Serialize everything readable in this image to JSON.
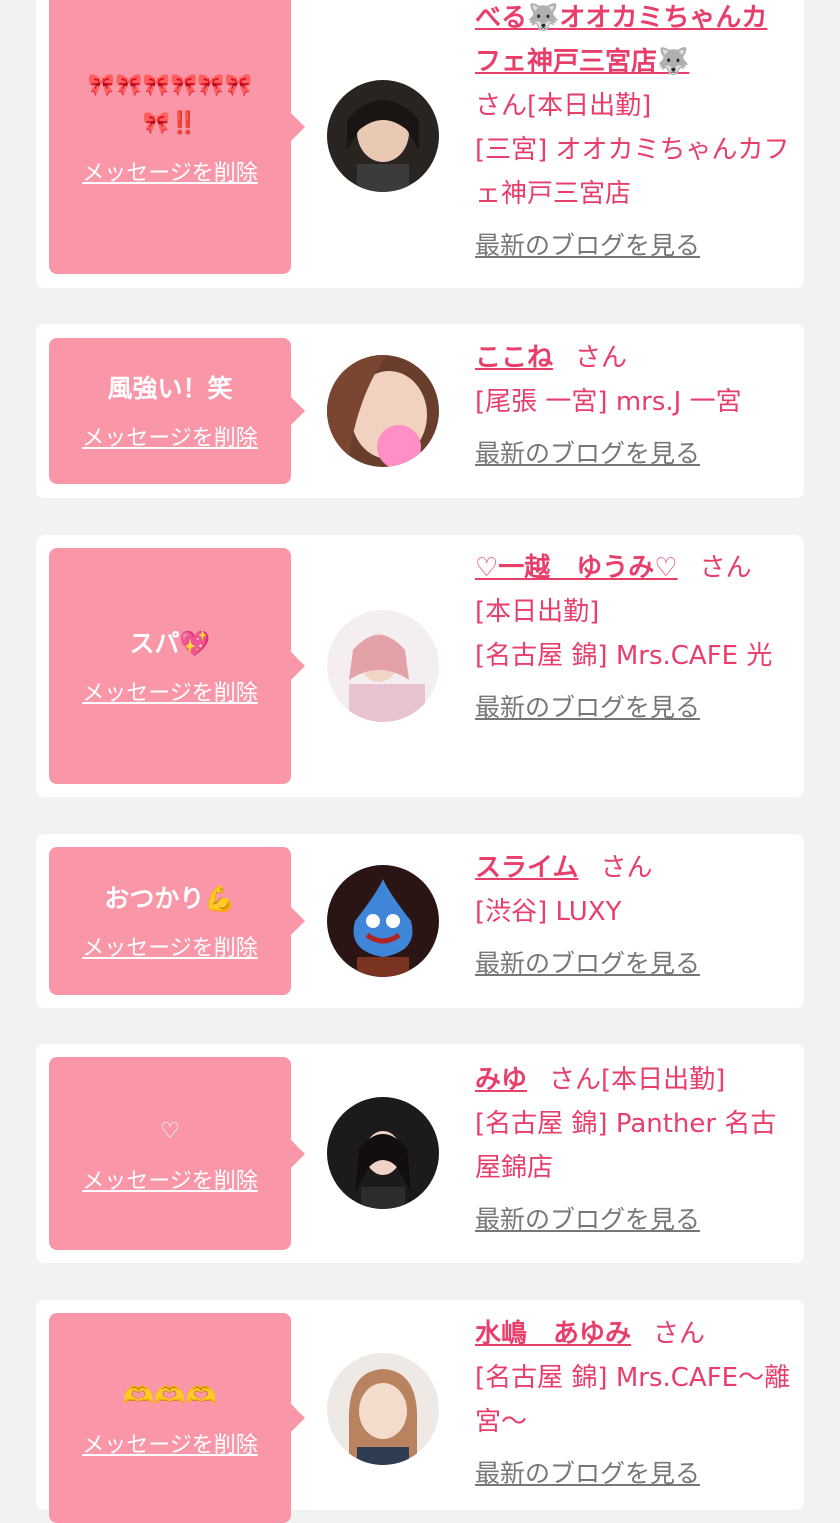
{
  "colors": {
    "accent": "#e83e6c",
    "bubble": "#f997a8",
    "background": "#f2f2f2",
    "card": "#ffffff",
    "blog_link": "#777777"
  },
  "common": {
    "delete_label": "メッセージを削除",
    "blog_label": "最新のブログを見る",
    "san_label": "さん"
  },
  "cards": [
    {
      "message": "🎀🎀🎀🎀🎀🎀🎀‼️",
      "name": "べる🐺オオカミちゃんカフェ神戸三宮店🐺",
      "san_line": "さん[本日出勤]",
      "shop": "[三宮] オオカミちゃんカフェ神戸三宮店",
      "avatar_icon": "user-photo-icon"
    },
    {
      "message": "風強い！笑",
      "name": "ここね",
      "san_line": "さん",
      "shop": "[尾張 一宮] mrs.J 一宮",
      "avatar_icon": "user-photo-icon"
    },
    {
      "message": "スパ💖",
      "name": "♡一越　ゆうみ♡",
      "san_line": "さん",
      "status": "[本日出勤]",
      "shop": "[名古屋 錦] Mrs.CAFE 光",
      "avatar_icon": "user-photo-icon"
    },
    {
      "message": "おつかり💪",
      "name": "スライム",
      "san_line": "さん",
      "shop": "[渋谷] LUXY",
      "avatar_icon": "user-photo-icon"
    },
    {
      "message": "♡",
      "name": "みゆ",
      "san_line": "さん[本日出勤]",
      "shop": "[名古屋 錦] Panther 名古屋錦店",
      "avatar_icon": "user-photo-icon"
    },
    {
      "message": "🫶🫶🫶",
      "name": "水嶋　あゆみ",
      "san_line": "さん",
      "shop": "[名古屋 錦] Mrs.CAFE〜離宮〜",
      "avatar_icon": "user-photo-icon"
    }
  ]
}
